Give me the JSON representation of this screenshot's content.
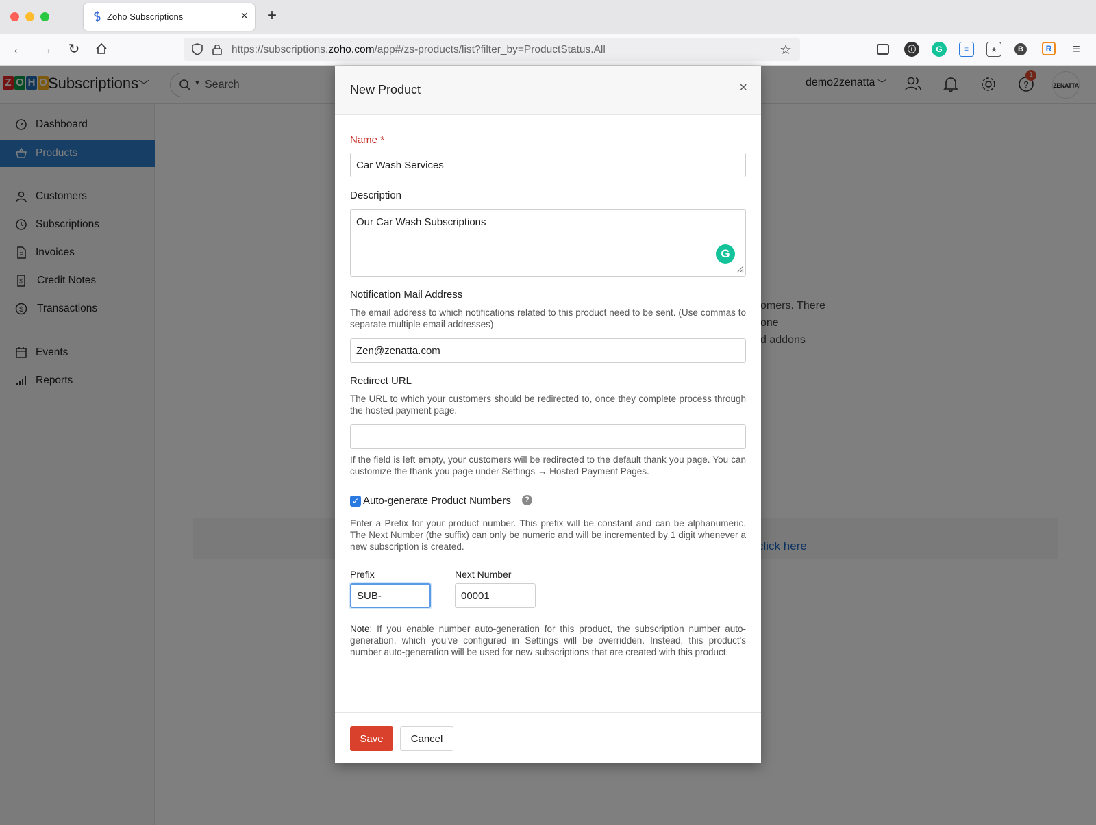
{
  "browser": {
    "tab_title": "Zoho Subscriptions",
    "url_prefix": "https://subscriptions.",
    "url_domain": "zoho.com",
    "url_path": "/app#/zs-products/list?filter_by=ProductStatus.All"
  },
  "app": {
    "logo_letters": [
      "Z",
      "O",
      "H",
      "O"
    ],
    "name": "Subscriptions",
    "search_placeholder": "Search",
    "org_name": "demo2zenatta",
    "notification_count": "1",
    "avatar_text": "ZENATTA"
  },
  "sidebar": {
    "items": [
      {
        "label": "Dashboard",
        "icon": "dashboard-icon"
      },
      {
        "label": "Products",
        "icon": "basket-icon",
        "active": true
      },
      {
        "label": "Customers",
        "icon": "user-icon"
      },
      {
        "label": "Subscriptions",
        "icon": "clock-icon"
      },
      {
        "label": "Invoices",
        "icon": "document-icon"
      },
      {
        "label": "Credit Notes",
        "icon": "credit-note-icon"
      },
      {
        "label": "Transactions",
        "icon": "dollar-icon"
      },
      {
        "label": "Events",
        "icon": "calendar-icon"
      },
      {
        "label": "Reports",
        "icon": "bar-chart-icon"
      }
    ]
  },
  "background": {
    "line1": "omers. There",
    "line2": "one",
    "line3": "d addons",
    "link": "click here"
  },
  "modal": {
    "title": "New Product",
    "name_label": "Name",
    "name_required": "*",
    "name_value": "Car Wash Services",
    "description_label": "Description",
    "description_value": "Our Car Wash Subscriptions",
    "notification_label": "Notification Mail Address",
    "notification_help": "The email address to which notifications related to this product need to be sent. (Use commas to separate multiple email addresses)",
    "notification_value": "Zen@zenatta.com",
    "redirect_label": "Redirect URL",
    "redirect_help": "The URL to which your customers should be redirected to, once they complete process through the hosted payment page.",
    "redirect_value": "",
    "redirect_footer": "If the field is left empty, your customers will be redirected to the default thank you page. You can customize the thank you page under Settings → Hosted Payment Pages.",
    "autogen_label": "Auto-generate Product Numbers",
    "autogen_checked": true,
    "autogen_help": "Enter a Prefix for your product number. This prefix will be constant and can be alphanumeric. The Next Number (the suffix) can only be numeric and will be incremented by 1 digit whenever a new subscription is created.",
    "prefix_label": "Prefix",
    "prefix_value": "SUB-",
    "next_number_label": "Next Number",
    "next_number_value": "00001",
    "note_label": "Note:",
    "note_text": " If you enable number auto-generation for this product, the subscription number auto-generation, which you've configured in Settings will be overridden. Instead, this product's number auto-generation will be used for new subscriptions that are created with this product.",
    "save_label": "Save",
    "cancel_label": "Cancel"
  },
  "colors": {
    "accent": "#2f7fcc",
    "save": "#d9412c",
    "required": "#c8312a",
    "grammarly": "#15c39a"
  }
}
